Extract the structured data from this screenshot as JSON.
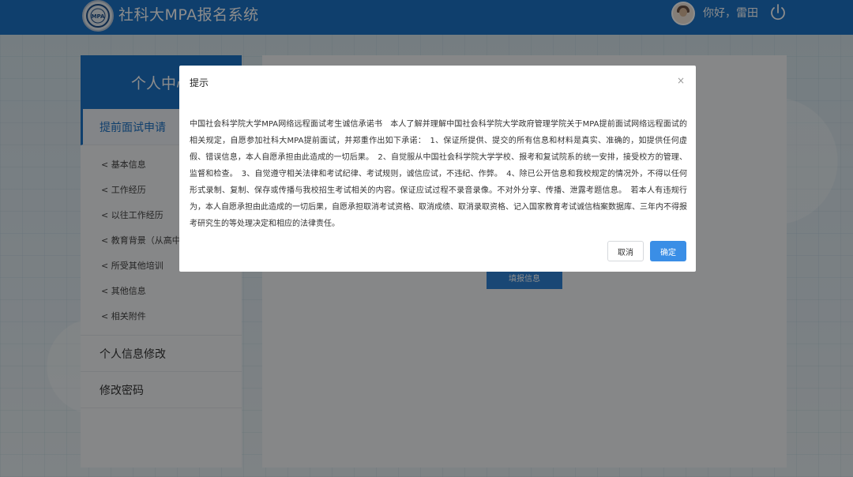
{
  "header": {
    "app_title": "社科大MPA报名系统",
    "greeting": "你好，雷田",
    "logo_icon": "university-seal-icon",
    "power_icon": "power-icon",
    "brand_color": "#1d73c7"
  },
  "sidebar": {
    "title": "个人中心",
    "sections": [
      {
        "label": "提前面试申请",
        "active": true,
        "items": [
          "< 基本信息",
          "< 工作经历",
          "< 以往工作经历",
          "< 教育背景（从高中起",
          "< 所受其他培训",
          "< 其他信息",
          "< 相关附件"
        ]
      },
      {
        "label": "个人信息修改",
        "active": false
      },
      {
        "label": "修改密码",
        "active": false
      }
    ]
  },
  "main": {
    "fill_button_label": "填报信息"
  },
  "dialog": {
    "title": "提示",
    "close_icon": "×",
    "body": "中国社会科学院大学MPA网络远程面试考生诚信承诺书　本人了解并理解中国社会科学院大学政府管理学院关于MPA提前面试网络远程面试的相关规定，自愿参加社科大MPA提前面试，并郑重作出如下承诺：　1、保证所提供、提交的所有信息和材料是真实、准确的，如提供任何虚假、错误信息，本人自愿承担由此造成的一切后果。　2、自觉服从中国社会科学院大学学校、报考和复试院系的统一安排，接受校方的管理、监督和检查。　3、自觉遵守相关法律和考试纪律、考试规则，诚信应试，不违纪、作弊。　4、除已公开信息和我校规定的情况外，不得以任何形式录制、复制、保存或传播与我校招生考试相关的内容。保证应试过程不录音录像。不对外分享、传播、泄露考题信息。　若本人有违规行为，本人自愿承担由此造成的一切后果，自愿承担取消考试资格、取消成绩、取消录取资格、记入国家教育考试诚信档案数据库、三年内不得报考研究生的等处理决定和相应的法律责任。",
    "cancel_label": "取消",
    "ok_label": "确定"
  }
}
